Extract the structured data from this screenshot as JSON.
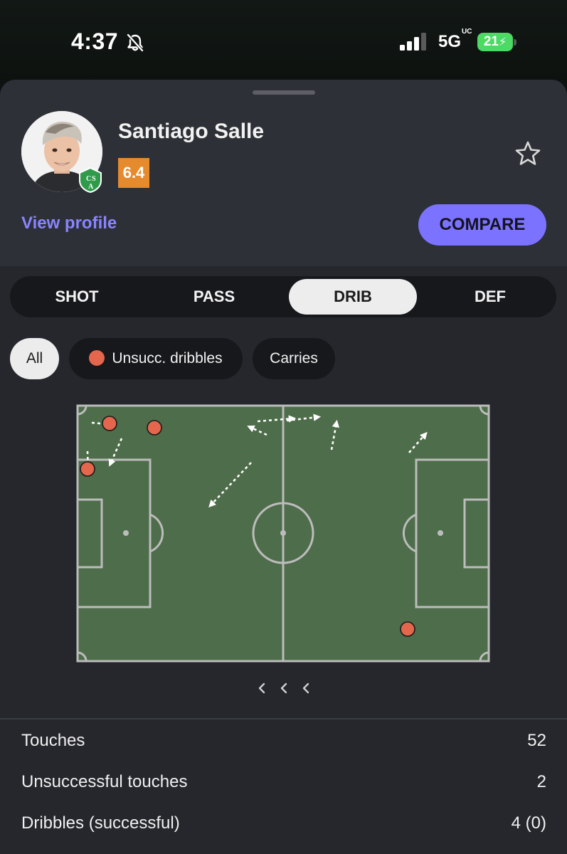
{
  "status_bar": {
    "time": "4:37",
    "network": "5G",
    "network_suffix": "UC",
    "battery": "21"
  },
  "player": {
    "name": "Santiago Salle",
    "rating": "6.4",
    "club_badge_text": "CSA",
    "view_profile_label": "View profile",
    "compare_label": "COMPARE"
  },
  "tabs": [
    {
      "label": "SHOT",
      "active": false
    },
    {
      "label": "PASS",
      "active": false
    },
    {
      "label": "DRIB",
      "active": true
    },
    {
      "label": "DEF",
      "active": false
    }
  ],
  "filters": [
    {
      "label": "All",
      "active": true
    },
    {
      "label": "Unsucc. dribbles",
      "active": false
    },
    {
      "label": "Carries",
      "active": false
    }
  ],
  "colors": {
    "pitch": "#4e6d4a",
    "pitch_lines": "#bcbcbc",
    "unsuccessful_dribble": "#e4664d",
    "accent": "#7b73ff",
    "rating": "#e68a2e"
  },
  "icons": {
    "mute": "bell-slash-icon",
    "favorite": "star-outline-icon",
    "direction": "chevron-left-icon"
  },
  "stats": [
    {
      "label": "Touches",
      "value": "52"
    },
    {
      "label": "Unsuccessful touches",
      "value": "2"
    },
    {
      "label": "Dribbles (successful)",
      "value": "4 (0)"
    }
  ]
}
